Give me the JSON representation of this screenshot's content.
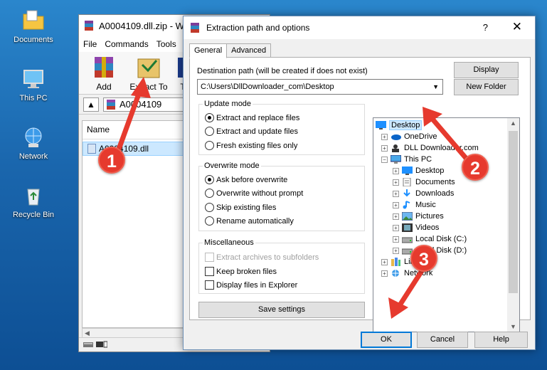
{
  "desktop": {
    "icons": [
      {
        "label": "Documents",
        "icon": "folder-icon"
      },
      {
        "label": "This PC",
        "icon": "computer-icon"
      },
      {
        "label": "Network",
        "icon": "network-icon"
      },
      {
        "label": "Recycle Bin",
        "icon": "recycle-bin-icon"
      }
    ]
  },
  "winrar": {
    "title": "A0004109.dll.zip - W",
    "menu": [
      "File",
      "Commands",
      "Tools"
    ],
    "toolbar": {
      "add_label": "Add",
      "extract_label": "Extract To",
      "extra_label": "T"
    },
    "address": "A0004109",
    "column_name": "Name",
    "file_name": "A0004109.dll"
  },
  "dialog": {
    "title": "Extraction path and options",
    "help_glyph": "?",
    "close_glyph": "✕",
    "tabs": [
      "General",
      "Advanced"
    ],
    "dest_label": "Destination path (will be created if does not exist)",
    "dest_value": "C:\\Users\\DllDownloader_com\\Desktop",
    "display_btn": "Display",
    "new_folder_btn": "New Folder",
    "update_mode": {
      "title": "Update mode",
      "options": [
        "Extract and replace files",
        "Extract and update files",
        "Fresh existing files only"
      ]
    },
    "overwrite_mode": {
      "title": "Overwrite mode",
      "options": [
        "Ask before overwrite",
        "Overwrite without prompt",
        "Skip existing files",
        "Rename automatically"
      ]
    },
    "misc": {
      "title": "Miscellaneous",
      "options": [
        "Extract archives to subfolders",
        "Keep broken files",
        "Display files in Explorer"
      ]
    },
    "save_settings": "Save settings",
    "tree": [
      {
        "label": "Desktop",
        "level": 0,
        "expander": "",
        "icon": "desktop-folder-icon",
        "selected": true
      },
      {
        "label": "OneDrive",
        "level": 1,
        "expander": "+",
        "icon": "onedrive-icon"
      },
      {
        "label": "DLL Downloader.com",
        "level": 1,
        "expander": "+",
        "icon": "user-icon"
      },
      {
        "label": "This PC",
        "level": 1,
        "expander": "−",
        "icon": "computer-icon"
      },
      {
        "label": "Desktop",
        "level": 2,
        "expander": "+",
        "icon": "desktop-folder-icon"
      },
      {
        "label": "Documents",
        "level": 2,
        "expander": "+",
        "icon": "documents-icon"
      },
      {
        "label": "Downloads",
        "level": 2,
        "expander": "+",
        "icon": "downloads-icon"
      },
      {
        "label": "Music",
        "level": 2,
        "expander": "+",
        "icon": "music-icon"
      },
      {
        "label": "Pictures",
        "level": 2,
        "expander": "+",
        "icon": "pictures-icon"
      },
      {
        "label": "Videos",
        "level": 2,
        "expander": "+",
        "icon": "videos-icon"
      },
      {
        "label": "Local Disk (C:)",
        "level": 2,
        "expander": "+",
        "icon": "drive-icon"
      },
      {
        "label": "Local Disk (D:)",
        "level": 2,
        "expander": "+",
        "icon": "drive-icon"
      },
      {
        "label": "Libraries",
        "level": 1,
        "expander": "+",
        "icon": "libraries-icon"
      },
      {
        "label": "Network",
        "level": 1,
        "expander": "+",
        "icon": "network-icon"
      }
    ],
    "ok_btn": "OK",
    "cancel_btn": "Cancel",
    "help_btn": "Help"
  },
  "annotations": [
    "1",
    "2",
    "3"
  ],
  "colors": {
    "badge": "#e63a2e",
    "selection": "#cce8ff",
    "accent": "#0078d7"
  }
}
